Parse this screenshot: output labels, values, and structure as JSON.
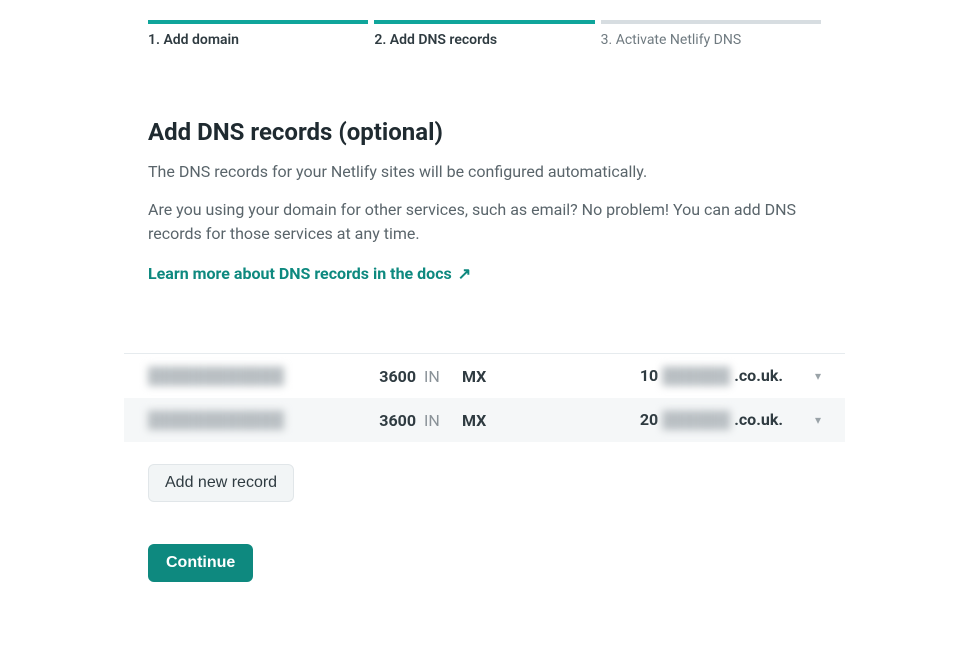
{
  "stepper": {
    "steps": [
      {
        "label": "1. Add domain",
        "state": "done"
      },
      {
        "label": "2. Add DNS records",
        "state": "active"
      },
      {
        "label": "3. Activate Netlify DNS",
        "state": "pending"
      }
    ]
  },
  "page": {
    "title": "Add DNS records (optional)",
    "desc1": "The DNS records for your Netlify sites will be configured automatically.",
    "desc2": "Are you using your domain for other services, such as email? No problem! You can add DNS records for those services at any time.",
    "docs_link": "Learn more about DNS records in the docs",
    "docs_arrow": "↗"
  },
  "records": [
    {
      "domain_blurred": "████████████",
      "ttl": "3600",
      "in": "IN",
      "type": "MX",
      "priority": "10",
      "value_blurred": "██████",
      "value_suffix": ".co.uk."
    },
    {
      "domain_blurred": "████████████",
      "ttl": "3600",
      "in": "IN",
      "type": "MX",
      "priority": "20",
      "value_blurred": "██████",
      "value_suffix": ".co.uk."
    }
  ],
  "buttons": {
    "add_new": "Add new record",
    "continue": "Continue"
  }
}
